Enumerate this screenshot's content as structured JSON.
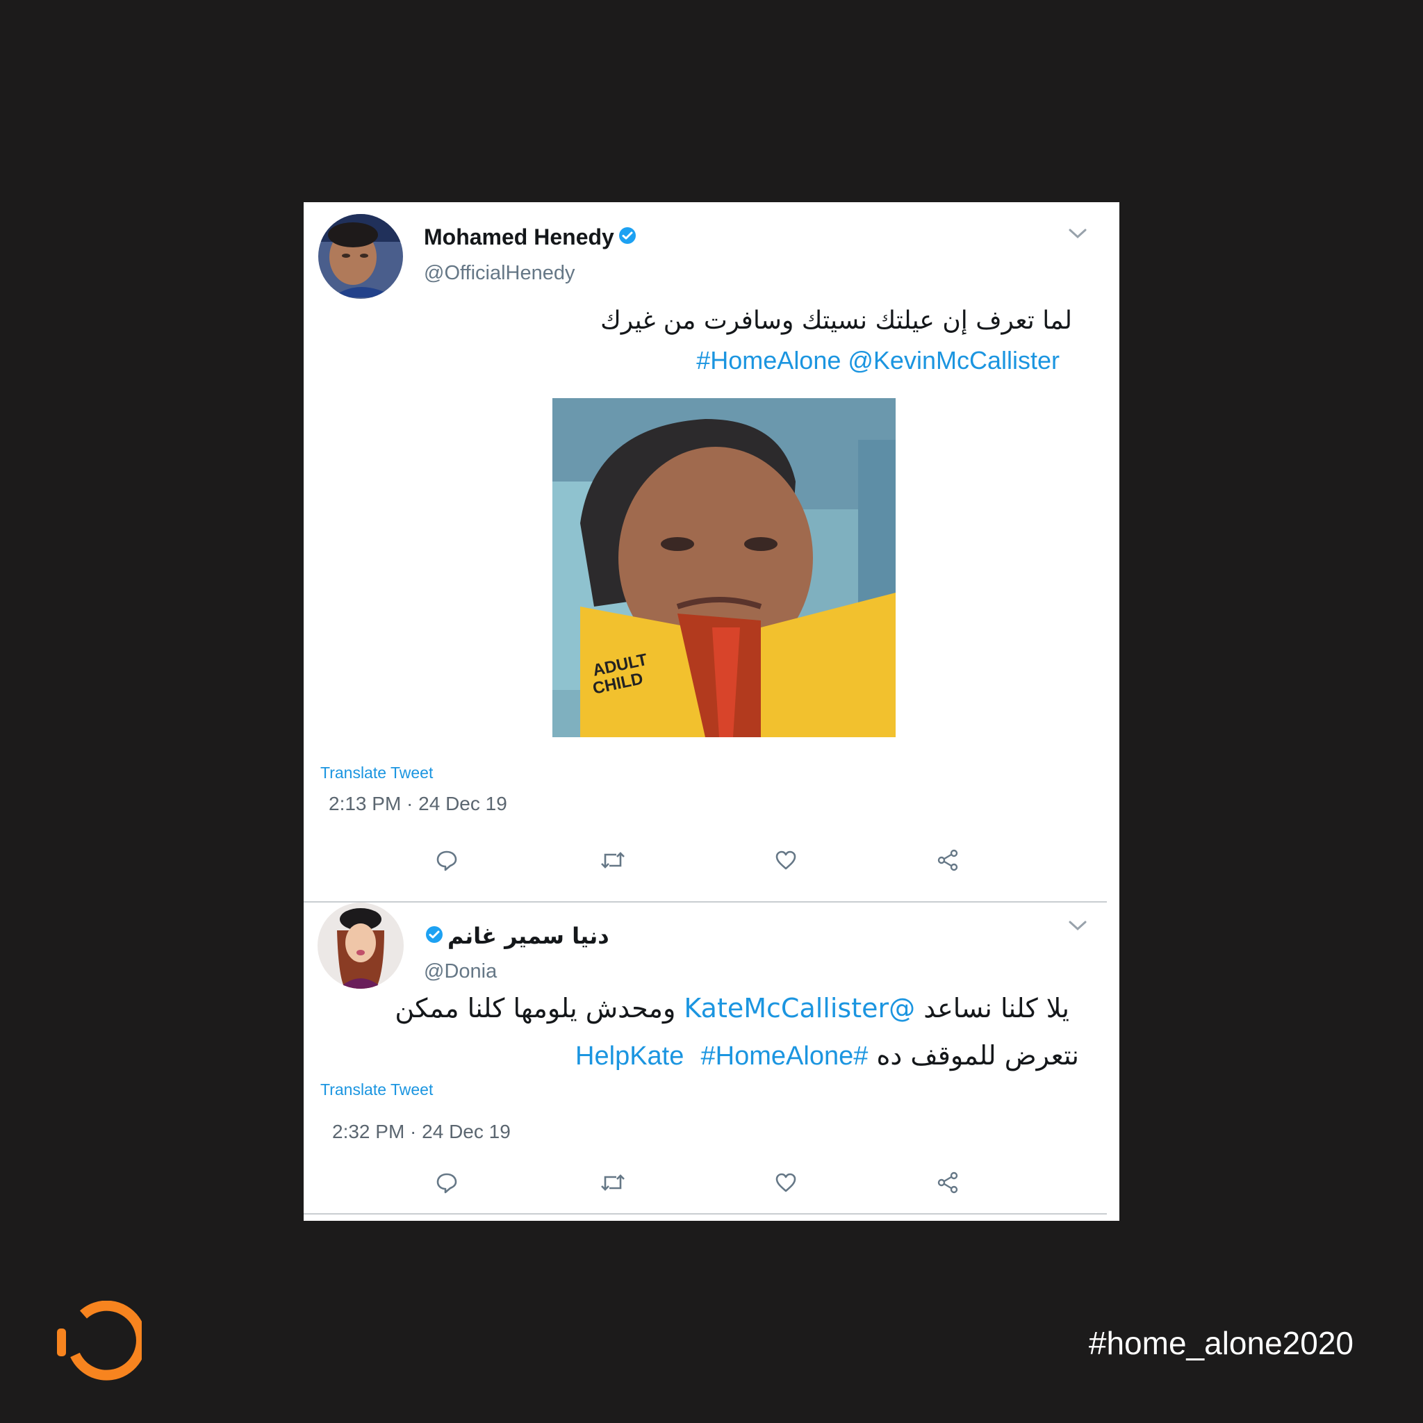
{
  "tweets": [
    {
      "author_name": "Mohamed Henedy",
      "handle": "@OfficialHenedy",
      "text_arabic": "لما تعرف إن عيلتك نسيتك وسافرت من غيرك",
      "tags_line": "#HomeAlone @KevinMcCallister",
      "translate_label": "Translate Tweet",
      "timestamp": "2:13 PM · 24 Dec 19",
      "media_caption_lines": [
        "ADULT",
        "CHILD"
      ]
    },
    {
      "author_name": "دنيا سمير غانم",
      "handle": "@Donia",
      "line1_before": "يلا كلنا نساعد ",
      "line1_mention": "@KateMcCallister",
      "line1_after": " ومحدش يلومها كلنا ممكن",
      "line2_text": "نتعرض للموقف ده ",
      "line2_tag1": "#HelpKate",
      "line2_tag2": "#HomeAlone",
      "translate_label": "Translate Tweet",
      "timestamp": "2:32 PM · 24 Dec 19"
    }
  ],
  "action_icons": [
    "reply-icon",
    "retweet-icon",
    "like-icon",
    "share-icon"
  ],
  "footer": {
    "hashtag": "#home_alone2020"
  },
  "colors": {
    "background": "#1c1b1b",
    "link_blue": "#1b95e0",
    "brand_orange": "#f7841f",
    "verified_blue": "#1da1f2"
  }
}
